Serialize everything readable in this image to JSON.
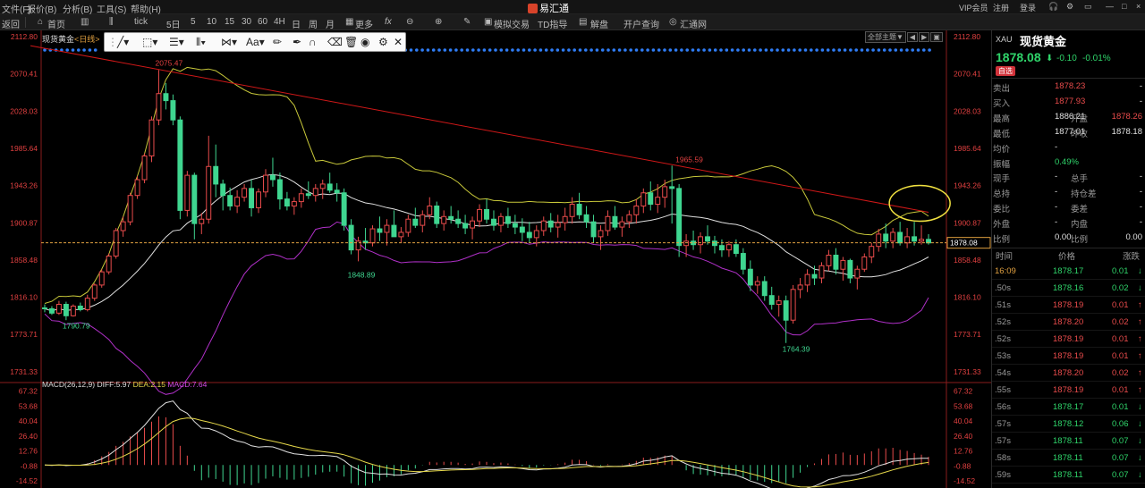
{
  "menubar": {
    "items": [
      "文件(F)",
      "报价(B)",
      "分析(B)",
      "工具(S)",
      "帮助(H)"
    ],
    "brand": "易汇通",
    "right_items": [
      "VIP会员",
      "注册",
      "登录"
    ]
  },
  "toolbar": {
    "items": [
      "返回",
      "首页",
      "",
      "tick",
      "5日",
      "5",
      "10",
      "15",
      "30",
      "60",
      "4H",
      "日",
      "周",
      "月",
      "更多",
      "",
      "",
      "",
      "",
      "模拟交易",
      "",
      "TD指导",
      "解盘",
      "开户查询",
      "汇通网"
    ]
  },
  "drawtools": {
    "icons": [
      "drag-handle-icon",
      "line-tool-icon",
      "rect-tool-icon",
      "fib-tool-icon",
      "channel-tool-icon",
      "pattern-tool-icon",
      "text-tool-icon",
      "pencil-icon",
      "pen-icon",
      "magnet-icon",
      "eraser-icon",
      "trash-icon",
      "eye-icon",
      "settings-icon",
      "close-icon"
    ],
    "text_label": "Aa"
  },
  "chart_header": {
    "instrument": "现货黄金",
    "timeframe": "<日线>",
    "buttons": [
      "全部主题▼",
      "◀",
      "▶",
      "▣"
    ]
  },
  "chart_data": {
    "type": "candlestick",
    "instrument": "现货黄金",
    "timeframe": "日线",
    "price_axis_ticks": [
      2112.8,
      2070.41,
      2028.03,
      1985.64,
      1943.26,
      1900.87,
      1858.48,
      1816.1,
      1773.71,
      1731.33
    ],
    "ylim": [
      1721,
      2120
    ],
    "last_price": 1878.08,
    "annotations": [
      {
        "text": "2075.47",
        "value": 2075.47,
        "index": 16
      },
      {
        "text": "1790.79",
        "value": 1790.79,
        "index": 3
      },
      {
        "text": "1848.89",
        "value": 1848.89,
        "index": 43
      },
      {
        "text": "1965.59",
        "value": 1965.59,
        "index": 89
      },
      {
        "text": "1764.39",
        "value": 1764.39,
        "index": 104
      }
    ],
    "candles": [
      [
        1804,
        1808,
        1799,
        1803
      ],
      [
        1803,
        1806,
        1796,
        1798
      ],
      [
        1798,
        1812,
        1796,
        1808
      ],
      [
        1808,
        1811,
        1790,
        1795
      ],
      [
        1795,
        1808,
        1794,
        1806
      ],
      [
        1806,
        1810,
        1800,
        1802
      ],
      [
        1802,
        1819,
        1800,
        1815
      ],
      [
        1815,
        1832,
        1812,
        1830
      ],
      [
        1830,
        1848,
        1827,
        1845
      ],
      [
        1845,
        1866,
        1842,
        1863
      ],
      [
        1863,
        1895,
        1860,
        1892
      ],
      [
        1892,
        1908,
        1885,
        1902
      ],
      [
        1902,
        1935,
        1898,
        1932
      ],
      [
        1932,
        1954,
        1928,
        1950
      ],
      [
        1950,
        1980,
        1946,
        1977
      ],
      [
        1977,
        2022,
        1970,
        2018
      ],
      [
        2018,
        2075,
        2012,
        2048
      ],
      [
        2048,
        2060,
        2030,
        2040
      ],
      [
        2040,
        2047,
        2012,
        2018
      ],
      [
        2018,
        2022,
        1905,
        1915
      ],
      [
        1915,
        1960,
        1908,
        1955
      ],
      [
        1955,
        1958,
        1882,
        1900
      ],
      [
        1900,
        1912,
        1888,
        1905
      ],
      [
        1905,
        2000,
        1900,
        1965
      ],
      [
        1965,
        1990,
        1930,
        1945
      ],
      [
        1945,
        1950,
        1915,
        1932
      ],
      [
        1932,
        1941,
        1915,
        1920
      ],
      [
        1920,
        1938,
        1912,
        1930
      ],
      [
        1930,
        1945,
        1925,
        1940
      ],
      [
        1940,
        1950,
        1908,
        1918
      ],
      [
        1918,
        1940,
        1912,
        1936
      ],
      [
        1936,
        1962,
        1930,
        1955
      ],
      [
        1955,
        1975,
        1942,
        1950
      ],
      [
        1950,
        1958,
        1916,
        1928
      ],
      [
        1928,
        1936,
        1915,
        1920
      ],
      [
        1920,
        1930,
        1910,
        1925
      ],
      [
        1925,
        1940,
        1918,
        1934
      ],
      [
        1934,
        1948,
        1928,
        1932
      ],
      [
        1932,
        1945,
        1925,
        1940
      ],
      [
        1940,
        1950,
        1928,
        1945
      ],
      [
        1945,
        1958,
        1935,
        1938
      ],
      [
        1938,
        1946,
        1925,
        1935
      ],
      [
        1935,
        1940,
        1892,
        1898
      ],
      [
        1898,
        1905,
        1865,
        1870
      ],
      [
        1870,
        1885,
        1857,
        1880
      ],
      [
        1880,
        1895,
        1870,
        1878
      ],
      [
        1878,
        1898,
        1874,
        1894
      ],
      [
        1894,
        1908,
        1880,
        1890
      ],
      [
        1890,
        1905,
        1875,
        1898
      ],
      [
        1898,
        1915,
        1890,
        1885
      ],
      [
        1885,
        1896,
        1878,
        1890
      ],
      [
        1890,
        1910,
        1885,
        1905
      ],
      [
        1905,
        1918,
        1895,
        1898
      ],
      [
        1898,
        1915,
        1890,
        1910
      ],
      [
        1910,
        1930,
        1905,
        1920
      ],
      [
        1920,
        1925,
        1895,
        1900
      ],
      [
        1900,
        1915,
        1892,
        1908
      ],
      [
        1908,
        1920,
        1900,
        1905
      ],
      [
        1905,
        1915,
        1895,
        1900
      ],
      [
        1900,
        1910,
        1888,
        1895
      ],
      [
        1895,
        1908,
        1882,
        1903
      ],
      [
        1903,
        1922,
        1896,
        1916
      ],
      [
        1916,
        1928,
        1900,
        1905
      ],
      [
        1905,
        1915,
        1892,
        1898
      ],
      [
        1898,
        1912,
        1890,
        1908
      ],
      [
        1908,
        1918,
        1895,
        1900
      ],
      [
        1900,
        1910,
        1888,
        1896
      ],
      [
        1896,
        1906,
        1880,
        1890
      ],
      [
        1890,
        1902,
        1878,
        1884
      ],
      [
        1884,
        1898,
        1874,
        1892
      ],
      [
        1892,
        1908,
        1886,
        1903
      ],
      [
        1903,
        1912,
        1890,
        1896
      ],
      [
        1896,
        1910,
        1884,
        1901
      ],
      [
        1901,
        1918,
        1892,
        1908
      ],
      [
        1908,
        1930,
        1900,
        1922
      ],
      [
        1922,
        1935,
        1905,
        1910
      ],
      [
        1910,
        1920,
        1895,
        1902
      ],
      [
        1902,
        1910,
        1878,
        1885
      ],
      [
        1885,
        1898,
        1870,
        1892
      ],
      [
        1892,
        1915,
        1886,
        1908
      ],
      [
        1908,
        1920,
        1893,
        1896
      ],
      [
        1896,
        1908,
        1885,
        1902
      ],
      [
        1902,
        1915,
        1895,
        1910
      ],
      [
        1910,
        1928,
        1900,
        1920
      ],
      [
        1920,
        1940,
        1912,
        1935
      ],
      [
        1935,
        1948,
        1915,
        1922
      ],
      [
        1922,
        1945,
        1912,
        1930
      ],
      [
        1930,
        1950,
        1918,
        1942
      ],
      [
        1942,
        1966,
        1900,
        1940
      ],
      [
        1940,
        1945,
        1862,
        1875
      ],
      [
        1875,
        1888,
        1862,
        1880
      ],
      [
        1880,
        1892,
        1870,
        1876
      ],
      [
        1876,
        1890,
        1866,
        1885
      ],
      [
        1885,
        1898,
        1876,
        1880
      ],
      [
        1880,
        1886,
        1866,
        1875
      ],
      [
        1875,
        1882,
        1862,
        1870
      ],
      [
        1870,
        1880,
        1862,
        1876
      ],
      [
        1876,
        1882,
        1862,
        1866
      ],
      [
        1866,
        1872,
        1842,
        1848
      ],
      [
        1848,
        1858,
        1823,
        1830
      ],
      [
        1830,
        1840,
        1820,
        1834
      ],
      [
        1834,
        1840,
        1812,
        1818
      ],
      [
        1818,
        1828,
        1802,
        1808
      ],
      [
        1808,
        1818,
        1794,
        1812
      ],
      [
        1812,
        1818,
        1764,
        1790
      ],
      [
        1790,
        1830,
        1786,
        1825
      ],
      [
        1825,
        1838,
        1815,
        1830
      ],
      [
        1830,
        1848,
        1822,
        1842
      ],
      [
        1842,
        1852,
        1830,
        1838
      ],
      [
        1838,
        1856,
        1832,
        1852
      ],
      [
        1852,
        1870,
        1846,
        1864
      ],
      [
        1864,
        1872,
        1842,
        1848
      ],
      [
        1848,
        1862,
        1835,
        1858
      ],
      [
        1858,
        1860,
        1832,
        1838
      ],
      [
        1838,
        1852,
        1825,
        1848
      ],
      [
        1848,
        1866,
        1845,
        1862
      ],
      [
        1862,
        1878,
        1855,
        1874
      ],
      [
        1874,
        1894,
        1868,
        1888
      ],
      [
        1888,
        1900,
        1872,
        1880
      ],
      [
        1880,
        1895,
        1872,
        1890
      ],
      [
        1890,
        1902,
        1875,
        1878
      ],
      [
        1878,
        1895,
        1872,
        1885
      ],
      [
        1885,
        1902,
        1875,
        1880
      ],
      [
        1880,
        1898,
        1876,
        1882
      ],
      [
        1882,
        1888,
        1876,
        1878
      ]
    ],
    "macd": {
      "label": "MACD(26,12,9)",
      "diff_label": "DIFF:5.97",
      "dea_label": "DEA:2.15",
      "macd_label": "MACD:7.64",
      "axis_ticks": [
        67.32,
        53.68,
        40.04,
        26.4,
        12.76,
        -0.88,
        -14.52
      ],
      "ylim": [
        -21,
        72
      ]
    },
    "axis_labels": {
      "top_ticks_right": [
        "1858.48"
      ]
    }
  },
  "quote_panel": {
    "symbol": "XAU",
    "name": "现货黄金",
    "price": "1878.08",
    "change": "-0.10",
    "change_pct": "-0.01%",
    "badge": "自选",
    "rows": [
      {
        "l1": "卖出",
        "v1": "1878.23",
        "l2": "",
        "v2": "-"
      },
      {
        "l1": "买入",
        "v1": "1877.93",
        "l2": "",
        "v2": "-"
      },
      {
        "l1": "最高",
        "v1": "1886.21",
        "l2": "开盘",
        "v2": "1878.26"
      },
      {
        "l1": "最低",
        "v1": "1877.01",
        "l2": "昨收",
        "v2": "1878.18"
      },
      {
        "l1": "均价",
        "v1": "-",
        "l2": "",
        "v2": ""
      },
      {
        "l1": "振幅",
        "v1": "0.49%",
        "l2": "",
        "v2": ""
      },
      {
        "l1": "现手",
        "v1": "-",
        "l2": "总手",
        "v2": "-"
      },
      {
        "l1": "总持",
        "v1": "-",
        "l2": "持仓差",
        "v2": "-"
      },
      {
        "l1": "委比",
        "v1": "-",
        "l2": "委差",
        "v2": "-"
      },
      {
        "l1": "外盘",
        "v1": "-",
        "l2": "内盘",
        "v2": "-"
      },
      {
        "l1": "比例",
        "v1": "0.00",
        "l2": "比例",
        "v2": "0.00"
      }
    ],
    "tick_headers": [
      "时间",
      "价格",
      "涨跌"
    ],
    "ticks": [
      {
        "time": "16:09",
        "price": "1878.17",
        "chg": "0.01",
        "dir": "down"
      },
      {
        "time": ".50s",
        "price": "1878.16",
        "chg": "0.02",
        "dir": "down"
      },
      {
        "time": ".51s",
        "price": "1878.19",
        "chg": "0.01",
        "dir": "up"
      },
      {
        "time": ".52s",
        "price": "1878.20",
        "chg": "0.02",
        "dir": "up"
      },
      {
        "time": ".52s",
        "price": "1878.19",
        "chg": "0.01",
        "dir": "up"
      },
      {
        "time": ".53s",
        "price": "1878.19",
        "chg": "0.01",
        "dir": "up"
      },
      {
        "time": ".54s",
        "price": "1878.20",
        "chg": "0.02",
        "dir": "up"
      },
      {
        "time": ".55s",
        "price": "1878.19",
        "chg": "0.01",
        "dir": "up"
      },
      {
        "time": ".56s",
        "price": "1878.17",
        "chg": "0.01",
        "dir": "down"
      },
      {
        "time": ".57s",
        "price": "1878.12",
        "chg": "0.06",
        "dir": "down"
      },
      {
        "time": ".57s",
        "price": "1878.11",
        "chg": "0.07",
        "dir": "down"
      },
      {
        "time": ".58s",
        "price": "1878.11",
        "chg": "0.07",
        "dir": "down"
      },
      {
        "time": ".59s",
        "price": "1878.11",
        "chg": "0.07",
        "dir": "down"
      }
    ]
  },
  "colors": {
    "up": "#e84b4b",
    "down": "#2fd46a",
    "bull_candle": "#e84b4b",
    "bear_candle": "#3fd690",
    "trendline": "#d01818",
    "ma_white": "#e0e0e0",
    "boll_upper": "#c8c83a",
    "boll_lower": "#b030c8",
    "highlight_circle": "#f0e040",
    "last_price_line": "#e0a040"
  }
}
